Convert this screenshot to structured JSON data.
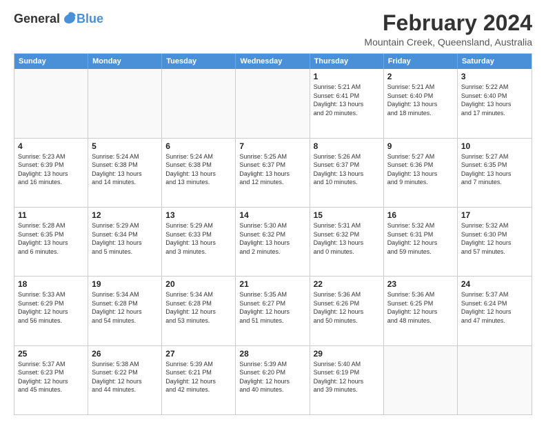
{
  "logo": {
    "general": "General",
    "blue": "Blue"
  },
  "title": "February 2024",
  "subtitle": "Mountain Creek, Queensland, Australia",
  "days_of_week": [
    "Sunday",
    "Monday",
    "Tuesday",
    "Wednesday",
    "Thursday",
    "Friday",
    "Saturday"
  ],
  "weeks": [
    [
      {
        "day": "",
        "info": "",
        "empty": true
      },
      {
        "day": "",
        "info": "",
        "empty": true
      },
      {
        "day": "",
        "info": "",
        "empty": true
      },
      {
        "day": "",
        "info": "",
        "empty": true
      },
      {
        "day": "1",
        "info": "Sunrise: 5:21 AM\nSunset: 6:41 PM\nDaylight: 13 hours\nand 20 minutes.",
        "empty": false
      },
      {
        "day": "2",
        "info": "Sunrise: 5:21 AM\nSunset: 6:40 PM\nDaylight: 13 hours\nand 18 minutes.",
        "empty": false
      },
      {
        "day": "3",
        "info": "Sunrise: 5:22 AM\nSunset: 6:40 PM\nDaylight: 13 hours\nand 17 minutes.",
        "empty": false
      }
    ],
    [
      {
        "day": "4",
        "info": "Sunrise: 5:23 AM\nSunset: 6:39 PM\nDaylight: 13 hours\nand 16 minutes.",
        "empty": false
      },
      {
        "day": "5",
        "info": "Sunrise: 5:24 AM\nSunset: 6:38 PM\nDaylight: 13 hours\nand 14 minutes.",
        "empty": false
      },
      {
        "day": "6",
        "info": "Sunrise: 5:24 AM\nSunset: 6:38 PM\nDaylight: 13 hours\nand 13 minutes.",
        "empty": false
      },
      {
        "day": "7",
        "info": "Sunrise: 5:25 AM\nSunset: 6:37 PM\nDaylight: 13 hours\nand 12 minutes.",
        "empty": false
      },
      {
        "day": "8",
        "info": "Sunrise: 5:26 AM\nSunset: 6:37 PM\nDaylight: 13 hours\nand 10 minutes.",
        "empty": false
      },
      {
        "day": "9",
        "info": "Sunrise: 5:27 AM\nSunset: 6:36 PM\nDaylight: 13 hours\nand 9 minutes.",
        "empty": false
      },
      {
        "day": "10",
        "info": "Sunrise: 5:27 AM\nSunset: 6:35 PM\nDaylight: 13 hours\nand 7 minutes.",
        "empty": false
      }
    ],
    [
      {
        "day": "11",
        "info": "Sunrise: 5:28 AM\nSunset: 6:35 PM\nDaylight: 13 hours\nand 6 minutes.",
        "empty": false
      },
      {
        "day": "12",
        "info": "Sunrise: 5:29 AM\nSunset: 6:34 PM\nDaylight: 13 hours\nand 5 minutes.",
        "empty": false
      },
      {
        "day": "13",
        "info": "Sunrise: 5:29 AM\nSunset: 6:33 PM\nDaylight: 13 hours\nand 3 minutes.",
        "empty": false
      },
      {
        "day": "14",
        "info": "Sunrise: 5:30 AM\nSunset: 6:32 PM\nDaylight: 13 hours\nand 2 minutes.",
        "empty": false
      },
      {
        "day": "15",
        "info": "Sunrise: 5:31 AM\nSunset: 6:32 PM\nDaylight: 13 hours\nand 0 minutes.",
        "empty": false
      },
      {
        "day": "16",
        "info": "Sunrise: 5:32 AM\nSunset: 6:31 PM\nDaylight: 12 hours\nand 59 minutes.",
        "empty": false
      },
      {
        "day": "17",
        "info": "Sunrise: 5:32 AM\nSunset: 6:30 PM\nDaylight: 12 hours\nand 57 minutes.",
        "empty": false
      }
    ],
    [
      {
        "day": "18",
        "info": "Sunrise: 5:33 AM\nSunset: 6:29 PM\nDaylight: 12 hours\nand 56 minutes.",
        "empty": false
      },
      {
        "day": "19",
        "info": "Sunrise: 5:34 AM\nSunset: 6:28 PM\nDaylight: 12 hours\nand 54 minutes.",
        "empty": false
      },
      {
        "day": "20",
        "info": "Sunrise: 5:34 AM\nSunset: 6:28 PM\nDaylight: 12 hours\nand 53 minutes.",
        "empty": false
      },
      {
        "day": "21",
        "info": "Sunrise: 5:35 AM\nSunset: 6:27 PM\nDaylight: 12 hours\nand 51 minutes.",
        "empty": false
      },
      {
        "day": "22",
        "info": "Sunrise: 5:36 AM\nSunset: 6:26 PM\nDaylight: 12 hours\nand 50 minutes.",
        "empty": false
      },
      {
        "day": "23",
        "info": "Sunrise: 5:36 AM\nSunset: 6:25 PM\nDaylight: 12 hours\nand 48 minutes.",
        "empty": false
      },
      {
        "day": "24",
        "info": "Sunrise: 5:37 AM\nSunset: 6:24 PM\nDaylight: 12 hours\nand 47 minutes.",
        "empty": false
      }
    ],
    [
      {
        "day": "25",
        "info": "Sunrise: 5:37 AM\nSunset: 6:23 PM\nDaylight: 12 hours\nand 45 minutes.",
        "empty": false
      },
      {
        "day": "26",
        "info": "Sunrise: 5:38 AM\nSunset: 6:22 PM\nDaylight: 12 hours\nand 44 minutes.",
        "empty": false
      },
      {
        "day": "27",
        "info": "Sunrise: 5:39 AM\nSunset: 6:21 PM\nDaylight: 12 hours\nand 42 minutes.",
        "empty": false
      },
      {
        "day": "28",
        "info": "Sunrise: 5:39 AM\nSunset: 6:20 PM\nDaylight: 12 hours\nand 40 minutes.",
        "empty": false
      },
      {
        "day": "29",
        "info": "Sunrise: 5:40 AM\nSunset: 6:19 PM\nDaylight: 12 hours\nand 39 minutes.",
        "empty": false
      },
      {
        "day": "",
        "info": "",
        "empty": true
      },
      {
        "day": "",
        "info": "",
        "empty": true
      }
    ]
  ]
}
